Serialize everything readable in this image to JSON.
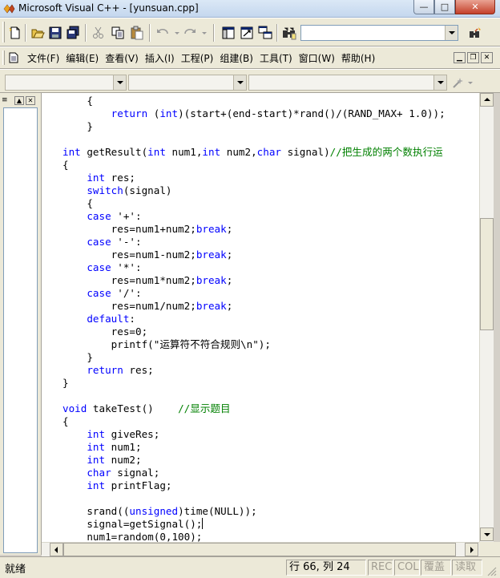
{
  "window": {
    "title": "Microsoft Visual C++ - [yunsuan.cpp]",
    "controls": {
      "minimize": "—",
      "maximize": "□",
      "close": "✕"
    }
  },
  "menu": {
    "items": [
      "文件(F)",
      "编辑(E)",
      "查看(V)",
      "插入(I)",
      "工程(P)",
      "组建(B)",
      "工具(T)",
      "窗口(W)",
      "帮助(H)"
    ]
  },
  "toolbar": {
    "find_value": "",
    "icons": [
      "new-file-icon",
      "open-folder-icon",
      "save-icon",
      "save-all-icon",
      "cut-icon",
      "copy-icon",
      "paste-icon",
      "undo-icon",
      "redo-icon",
      "workspace-icon",
      "output-icon",
      "window-list-icon",
      "find-in-files-icon",
      "find-icon"
    ]
  },
  "editor": {
    "lines": [
      [
        {
          "t": "    {"
        }
      ],
      [
        {
          "t": "        "
        },
        {
          "t": "return",
          "k": "kw"
        },
        {
          "t": " ("
        },
        {
          "t": "int",
          "k": "kw"
        },
        {
          "t": ")(start+(end-start)*rand()/(RAND_MAX+ 1.0));"
        }
      ],
      [
        {
          "t": "    }"
        }
      ],
      [
        {
          "t": ""
        }
      ],
      [
        {
          "t": "int",
          "k": "kw"
        },
        {
          "t": " getResult("
        },
        {
          "t": "int",
          "k": "kw"
        },
        {
          "t": " num1,"
        },
        {
          "t": "int",
          "k": "kw"
        },
        {
          "t": " num2,"
        },
        {
          "t": "char",
          "k": "kw"
        },
        {
          "t": " signal)"
        },
        {
          "t": "//把生成的两个数执行运",
          "k": "cm"
        }
      ],
      [
        {
          "t": "{"
        }
      ],
      [
        {
          "t": "    "
        },
        {
          "t": "int",
          "k": "kw"
        },
        {
          "t": " res;"
        }
      ],
      [
        {
          "t": "    "
        },
        {
          "t": "switch",
          "k": "kw"
        },
        {
          "t": "(signal)"
        }
      ],
      [
        {
          "t": "    {"
        }
      ],
      [
        {
          "t": "    "
        },
        {
          "t": "case",
          "k": "kw"
        },
        {
          "t": " '+':"
        }
      ],
      [
        {
          "t": "        res=num1+num2;"
        },
        {
          "t": "break",
          "k": "kw"
        },
        {
          "t": ";"
        }
      ],
      [
        {
          "t": "    "
        },
        {
          "t": "case",
          "k": "kw"
        },
        {
          "t": " '-':"
        }
      ],
      [
        {
          "t": "        res=num1-num2;"
        },
        {
          "t": "break",
          "k": "kw"
        },
        {
          "t": ";"
        }
      ],
      [
        {
          "t": "    "
        },
        {
          "t": "case",
          "k": "kw"
        },
        {
          "t": " '*':"
        }
      ],
      [
        {
          "t": "        res=num1*num2;"
        },
        {
          "t": "break",
          "k": "kw"
        },
        {
          "t": ";"
        }
      ],
      [
        {
          "t": "    "
        },
        {
          "t": "case",
          "k": "kw"
        },
        {
          "t": " '/':"
        }
      ],
      [
        {
          "t": "        res=num1/num2;"
        },
        {
          "t": "break",
          "k": "kw"
        },
        {
          "t": ";"
        }
      ],
      [
        {
          "t": "    "
        },
        {
          "t": "default",
          "k": "kw"
        },
        {
          "t": ":"
        }
      ],
      [
        {
          "t": "        res=0;"
        }
      ],
      [
        {
          "t": "        printf(\"运算符不符合规则\\n\");"
        }
      ],
      [
        {
          "t": "    }"
        }
      ],
      [
        {
          "t": "    "
        },
        {
          "t": "return",
          "k": "kw"
        },
        {
          "t": " res;"
        }
      ],
      [
        {
          "t": "}"
        }
      ],
      [
        {
          "t": ""
        }
      ],
      [
        {
          "t": "void",
          "k": "kw"
        },
        {
          "t": " takeTest()    "
        },
        {
          "t": "//显示题目",
          "k": "cm"
        }
      ],
      [
        {
          "t": "{"
        }
      ],
      [
        {
          "t": "    "
        },
        {
          "t": "int",
          "k": "kw"
        },
        {
          "t": " giveRes;"
        }
      ],
      [
        {
          "t": "    "
        },
        {
          "t": "int",
          "k": "kw"
        },
        {
          "t": " num1;"
        }
      ],
      [
        {
          "t": "    "
        },
        {
          "t": "int",
          "k": "kw"
        },
        {
          "t": " num2;"
        }
      ],
      [
        {
          "t": "    "
        },
        {
          "t": "char",
          "k": "kw"
        },
        {
          "t": " signal;"
        }
      ],
      [
        {
          "t": "    "
        },
        {
          "t": "int",
          "k": "kw"
        },
        {
          "t": " printFlag;"
        }
      ],
      [
        {
          "t": ""
        }
      ],
      [
        {
          "t": "    srand(("
        },
        {
          "t": "unsigned",
          "k": "kw"
        },
        {
          "t": ")time(NULL));"
        }
      ],
      [
        {
          "t": "    signal=getSignal();"
        },
        {
          "t": "",
          "k": "caret"
        }
      ],
      [
        {
          "t": "    num1=random(0,100);"
        }
      ]
    ]
  },
  "statusbar": {
    "ready": "就绪",
    "position": "行 66, 列 24",
    "rec": "REC",
    "col": "COL",
    "ovr": "覆盖",
    "read": "读取"
  }
}
